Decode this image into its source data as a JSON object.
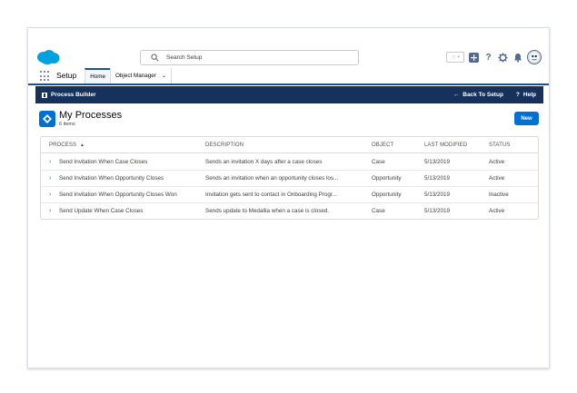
{
  "header": {
    "search_placeholder": "Search Setup",
    "icons": [
      "salesforce-logo",
      "search-icon",
      "favorites-star-icon",
      "global-actions-plus-icon",
      "help-icon",
      "setup-gear-icon",
      "notifications-bell-icon",
      "user-avatar"
    ]
  },
  "nav": {
    "app_name": "Setup",
    "tabs": [
      {
        "label": "Home",
        "active": true
      },
      {
        "label": "Object Manager",
        "has_menu": true
      }
    ]
  },
  "banner": {
    "title": "Process Builder",
    "back_label": "Back To Setup",
    "help_label": "Help"
  },
  "page": {
    "title": "My Processes",
    "count": "6 items",
    "new_button": "New"
  },
  "table": {
    "columns": {
      "process": "PROCESS",
      "description": "DESCRIPTION",
      "object": "OBJECT",
      "last_modified": "LAST MODIFIED",
      "status": "STATUS"
    },
    "sort": {
      "column": "PROCESS",
      "direction": "ascending"
    },
    "rows": [
      {
        "process": "Send Invitation When Case Closes",
        "description": "Sends an invitation X days after a case closes",
        "object": "Case",
        "last_modified": "5/13/2019",
        "status": "Active"
      },
      {
        "process": "Send Invitation When Opportunity Closes",
        "description": "Sends an invitation when an opportunity closes los...",
        "object": "Opportunity",
        "last_modified": "5/13/2019",
        "status": "Active"
      },
      {
        "process": "Send Invitation When Opportunity Closes Won",
        "description": "Invitation gets sent to contact in Onboarding Progr...",
        "object": "Opportunity",
        "last_modified": "5/13/2019",
        "status": "Inactive"
      },
      {
        "process": "Send Update When Case Closes",
        "description": "Sends update to Medallia when a case is closed.",
        "object": "Case",
        "last_modified": "5/13/2019",
        "status": "Active"
      }
    ]
  },
  "colors": {
    "brand_blue": "#0070d2",
    "banner_navy": "#16325c",
    "nav_underline": "#1b5297",
    "logo_blue": "#00a1e0"
  }
}
